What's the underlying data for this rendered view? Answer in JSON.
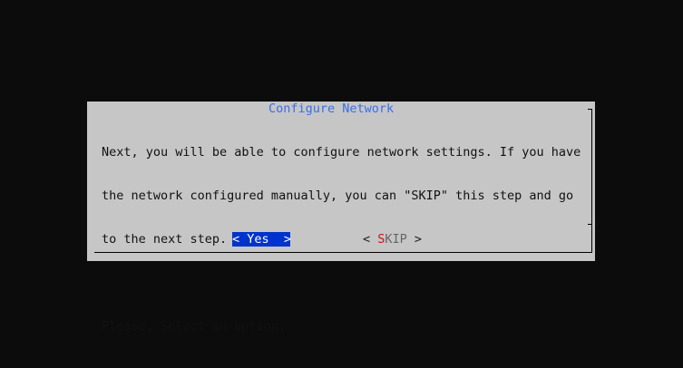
{
  "dialog": {
    "title": "Configure Network",
    "message_lines": [
      "Next, you will be able to configure network settings. If you have",
      "the network configured manually, you can \"SKIP\" this step and go",
      "to the next step.",
      "",
      "Please, Select an option."
    ],
    "buttons": {
      "yes": {
        "left": "<",
        "label": " Yes ",
        "right": " >"
      },
      "skip": {
        "left": "< ",
        "hotkey": "S",
        "rest": "KIP",
        "right": " >"
      }
    }
  },
  "colors": {
    "background": "#0c0c0c",
    "dialog": "#c6c6c6",
    "title": "#3a6ee8",
    "selected_button_bg": "#0033cc",
    "hotkey": "#c01818"
  }
}
